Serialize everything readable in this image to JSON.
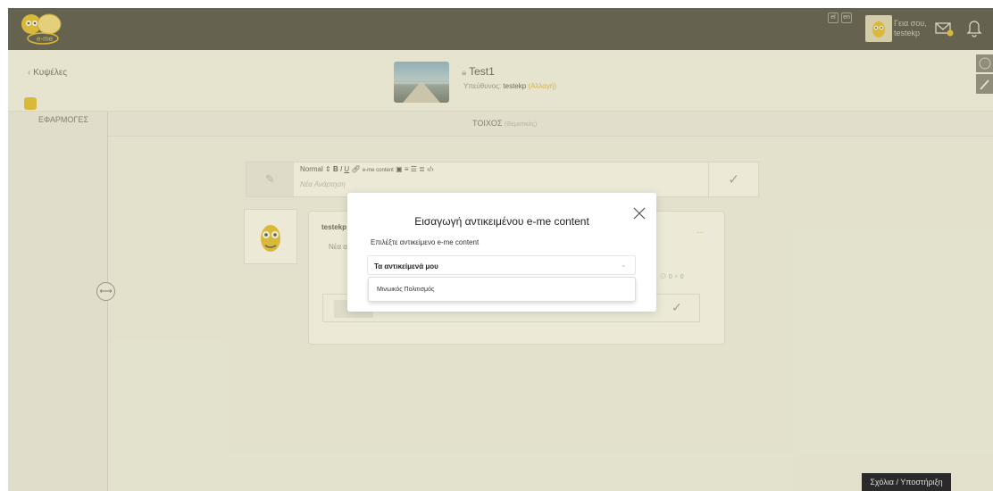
{
  "topbar": {
    "logo_text": "e-me",
    "lang_1": "el",
    "lang_2": "en",
    "greeting_line1": "Γεια σου,",
    "greeting_line2": "testekp"
  },
  "header": {
    "back_label": "Κυψέλες",
    "title": "Test1",
    "owner_prefix": "Υπεύθυνος:",
    "owner_name": "testekp",
    "owner_change": "(Αλλαγή)"
  },
  "sidebar": {
    "apps_label": "ΕΦΑΡΜΟΓΕΣ"
  },
  "wall": {
    "tab_label": "ΤΟΙΧΟΣ",
    "tab_sub": "(Θεματικός)"
  },
  "composer": {
    "toolbar_style": "Normal",
    "toolbar_emecontent": "e-me content",
    "placeholder": "Νέα Ανάρτηση"
  },
  "post": {
    "user": "testekp",
    "text": "Νέα α",
    "dots": "...",
    "comments_count": "0",
    "likes_count": "0"
  },
  "modal": {
    "title": "Εισαγωγή αντικειμένου e-me content",
    "select_label": "Επιλέξτε αντικείμενο e-me content",
    "select_value": "Τα αντικείμενά μου",
    "dropdown_item": "Μινωικός Πολιτισμός"
  },
  "footer": {
    "support_label": "Σχόλια / Υποστήριξη"
  },
  "colors": {
    "accent": "#e0b100",
    "topbar": "#262626"
  }
}
